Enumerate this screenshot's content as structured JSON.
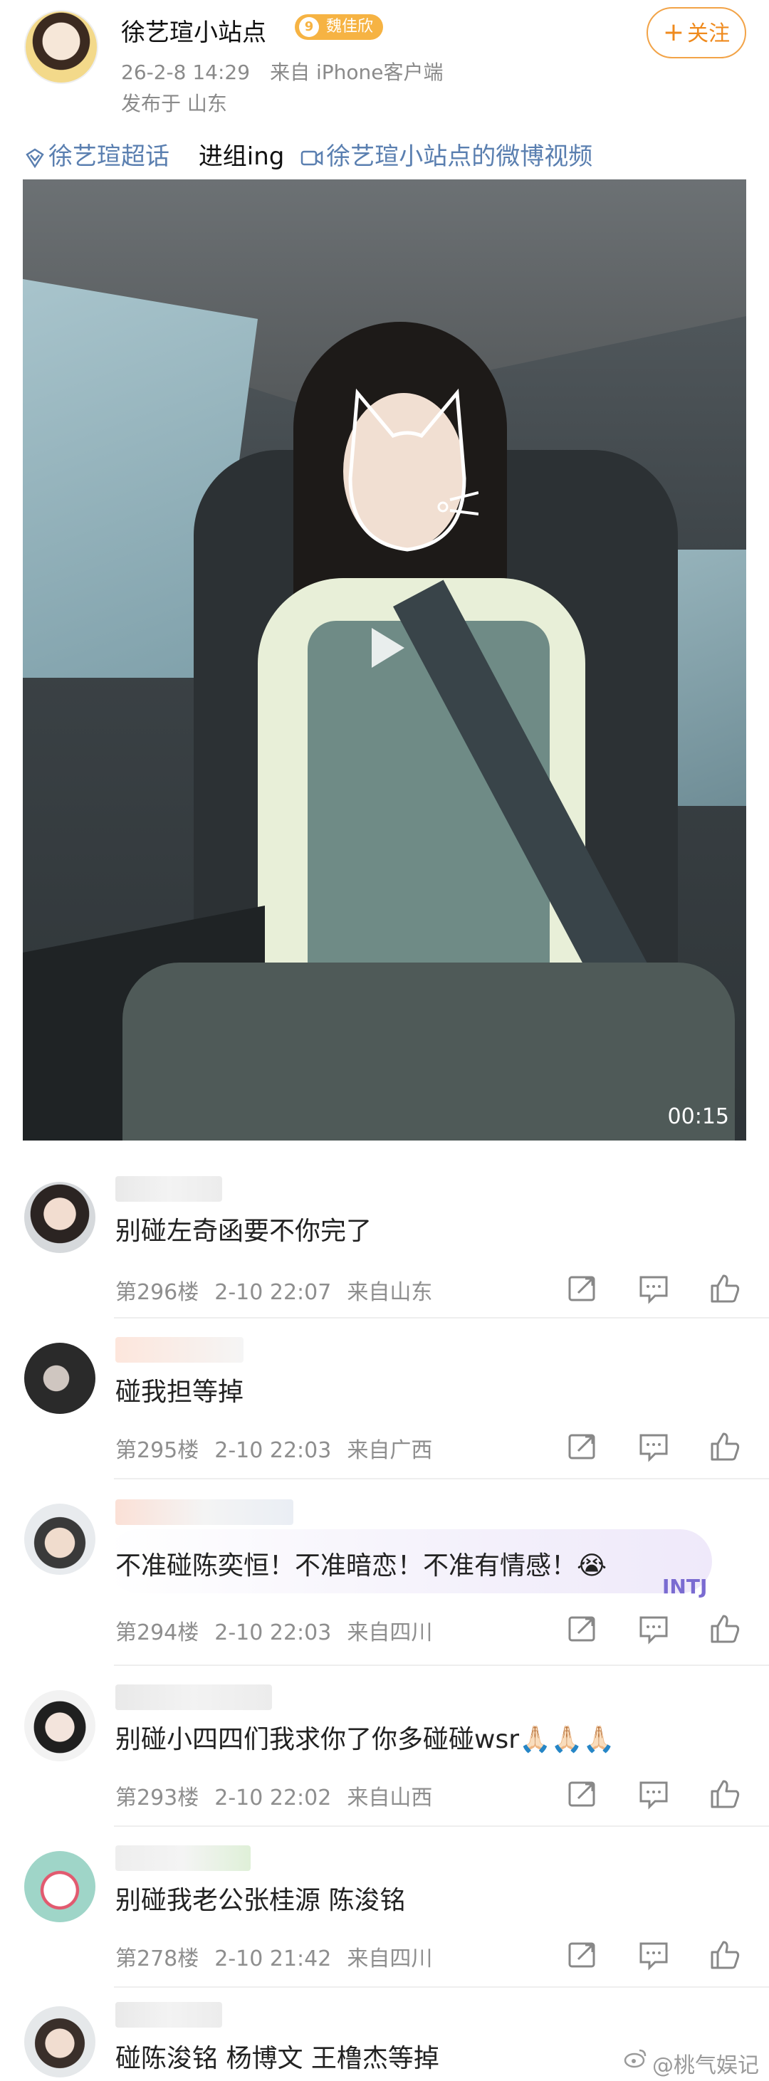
{
  "post": {
    "author": "徐艺瑄小站点",
    "badge": "魏佳欣",
    "badge_level": "9",
    "datetime": "26-2-8 14:29",
    "source": "来自 iPhone客户端",
    "location": "发布于 山东",
    "follow_label": "关注",
    "topic_super": "徐艺瑄超话",
    "topic_text": "进组ing",
    "topic_video": "徐艺瑄小站点的微博视频",
    "video_duration": "00:15"
  },
  "comments": [
    {
      "text": "别碰左奇函要不你完了",
      "floor": "第296楼",
      "time": "2-10 22:07",
      "loc": "来自山东"
    },
    {
      "text": "碰我担等掉",
      "floor": "第295楼",
      "time": "2-10 22:03",
      "loc": "来自广西"
    },
    {
      "text": "不准碰陈奕恒！不准暗恋！不准有情感！😭",
      "floor": "第294楼",
      "time": "2-10 22:03",
      "loc": "来自四川"
    },
    {
      "text": "别碰小四四们我求你了你多碰碰wsr🙏🏻🙏🏻🙏🏻",
      "floor": "第293楼",
      "time": "2-10 22:02",
      "loc": "来自山西"
    },
    {
      "text": "别碰我老公张桂源 陈浚铭",
      "floor": "第278楼",
      "time": "2-10 21:42",
      "loc": "来自四川"
    },
    {
      "text": "碰陈浚铭 杨博文 王橹杰等掉",
      "floor": "",
      "time": "",
      "loc": ""
    }
  ],
  "sticker_text": "INTJ",
  "watermark": "@桃气娱记",
  "icons": [
    "share-icon",
    "comment-icon",
    "like-icon",
    "super-topic-icon",
    "video-icon",
    "play-icon"
  ],
  "colors": {
    "follow": "#ef8a1d",
    "topic": "#5a7fb0",
    "badge": "#f6b343",
    "meta": "#8e8e8e"
  }
}
